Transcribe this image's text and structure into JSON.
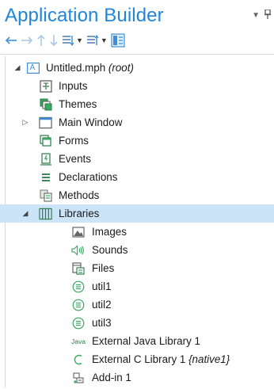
{
  "panel": {
    "title": "Application Builder"
  },
  "tree": {
    "root_label": "Untitled.mph",
    "root_suffix": "(root)",
    "items": [
      {
        "label": "Inputs"
      },
      {
        "label": "Themes"
      },
      {
        "label": "Main Window"
      },
      {
        "label": "Forms"
      },
      {
        "label": "Events"
      },
      {
        "label": "Declarations"
      },
      {
        "label": "Methods"
      },
      {
        "label": "Libraries"
      },
      {
        "label": "Images"
      },
      {
        "label": "Sounds"
      },
      {
        "label": "Files"
      },
      {
        "label": "util1"
      },
      {
        "label": "util2"
      },
      {
        "label": "util3"
      },
      {
        "label": "External Java Library 1"
      },
      {
        "label": "External C Library 1",
        "suffix": "{native1}"
      },
      {
        "label": "Add-in 1"
      }
    ],
    "java_badge": "Java",
    "root_badge": "A"
  }
}
